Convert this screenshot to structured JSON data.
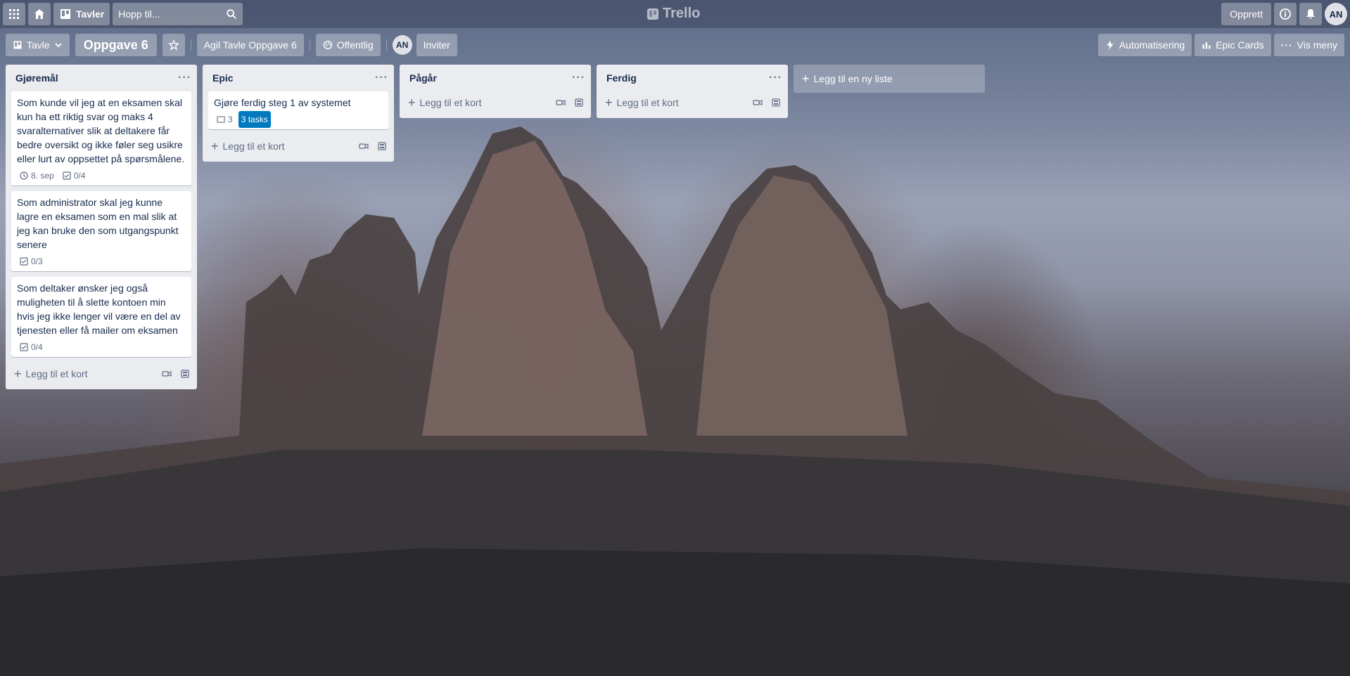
{
  "topbar": {
    "boards_label": "Tavler",
    "search_placeholder": "Hopp til...",
    "logo_text": "Trello",
    "create_label": "Opprett",
    "avatar_initials": "AN"
  },
  "boardbar": {
    "view_label": "Tavle",
    "board_title": "Oppgave 6",
    "workspace_label": "Agil Tavle Oppgave 6",
    "visibility_label": "Offentlig",
    "member_initials": "AN",
    "invite_label": "Inviter",
    "automation_label": "Automatisering",
    "epic_cards_label": "Epic Cards",
    "menu_label": "Vis meny"
  },
  "lists": [
    {
      "title": "Gjøremål",
      "cards": [
        {
          "text": "Som kunde vil jeg at en eksamen skal kun ha ett riktig svar og maks 4 svaralternativer slik at deltakere får bedre oversikt og ikke føler seg usikre eller lurt av oppsettet på spørsmålene.",
          "due": "8. sep",
          "checklist": "0/4"
        },
        {
          "text": "Som administrator skal jeg kunne lagre en eksamen som en mal slik at jeg kan bruke den som utgangspunkt senere",
          "checklist": "0/3"
        },
        {
          "text": "Som deltaker ønsker jeg også muligheten til å slette kontoen min hvis jeg ikke lenger vil være en del av tjenesten eller få mailer om eksamen",
          "checklist": "0/4"
        }
      ],
      "add_label": "Legg til et kort"
    },
    {
      "title": "Epic",
      "cards": [
        {
          "text": "Gjøre ferdig steg 1 av systemet",
          "count": "3",
          "tasks": "3 tasks"
        }
      ],
      "add_label": "Legg til et kort"
    },
    {
      "title": "Pågår",
      "add_label": "Legg til et kort"
    },
    {
      "title": "Ferdig",
      "add_label": "Legg til et kort"
    }
  ],
  "add_list_label": "Legg til en ny liste"
}
